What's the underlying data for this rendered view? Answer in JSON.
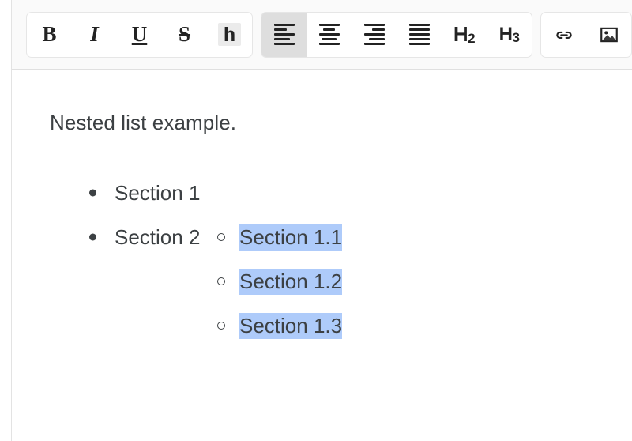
{
  "editor": {
    "toolbar": {
      "groups": [
        {
          "name": "text-format-group",
          "buttons": [
            {
              "name": "bold-button",
              "label": "B",
              "icon": "bold-icon",
              "active": false
            },
            {
              "name": "italic-button",
              "label": "I",
              "icon": "italic-icon",
              "active": false
            },
            {
              "name": "underline-button",
              "label": "U",
              "icon": "underline-icon",
              "active": false
            },
            {
              "name": "strikethrough-button",
              "label": "S",
              "icon": "strikethrough-icon",
              "active": false
            },
            {
              "name": "highlight-button",
              "label": "h",
              "icon": "highlight-icon",
              "active": true
            }
          ]
        },
        {
          "name": "paragraph-group",
          "buttons": [
            {
              "name": "align-left-button",
              "label": "",
              "icon": "align-left-icon",
              "active": true
            },
            {
              "name": "align-center-button",
              "label": "",
              "icon": "align-center-icon",
              "active": false
            },
            {
              "name": "align-right-button",
              "label": "",
              "icon": "align-right-icon",
              "active": false
            },
            {
              "name": "align-justify-button",
              "label": "",
              "icon": "align-justify-icon",
              "active": false
            },
            {
              "name": "heading-2-button",
              "label": "H2",
              "icon": "heading-2-icon",
              "active": false
            },
            {
              "name": "heading-3-button",
              "label": "H3",
              "icon": "heading-3-icon",
              "active": false
            }
          ]
        },
        {
          "name": "insert-group",
          "buttons": [
            {
              "name": "insert-link-button",
              "label": "",
              "icon": "link-icon",
              "active": false
            },
            {
              "name": "insert-image-button",
              "label": "",
              "icon": "image-icon",
              "active": false
            }
          ]
        }
      ]
    },
    "content": {
      "paragraph": "Nested list example.",
      "list": [
        {
          "text": "Section 1",
          "selected": false,
          "children": [
            {
              "text": "Section 1.1",
              "selected": true
            },
            {
              "text": "Section 1.2",
              "selected": true
            },
            {
              "text": "Section 1.3",
              "selected": true
            }
          ]
        },
        {
          "text": "Section 2",
          "selected": false,
          "children": []
        }
      ]
    },
    "colors": {
      "selection_highlight": "#aecbfa",
      "text": "#3c4043",
      "toolbar_background": "#fafafa",
      "active_button": "#dedede",
      "border": "#e0e0e0"
    }
  }
}
